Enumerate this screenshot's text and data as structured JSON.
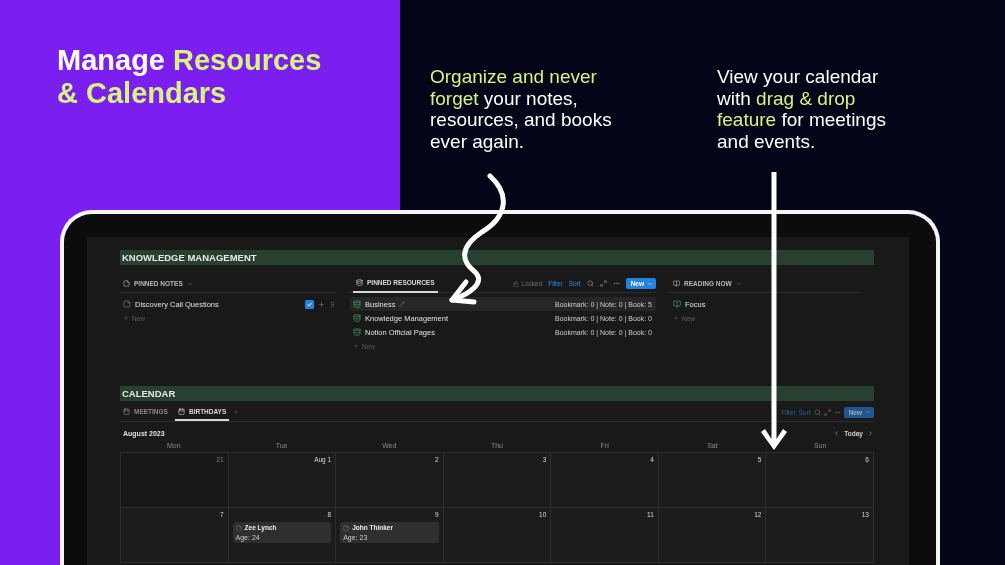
{
  "hero": {
    "title_lines": [
      [
        {
          "text": "Manage ",
          "highlight": false
        },
        {
          "text": "Resources",
          "highlight": true
        }
      ],
      [
        {
          "text": "& Calendars",
          "highlight": true
        }
      ]
    ],
    "captions": [
      [
        {
          "text": "Organize and never forget",
          "highlight": true
        },
        {
          "text": " your notes, resources, and books ever again.",
          "highlight": false
        }
      ],
      [
        {
          "text": "View your calendar with ",
          "highlight": false
        },
        {
          "text": "drag & drop feature",
          "highlight": true
        },
        {
          "text": " for meetings and events.",
          "highlight": false
        }
      ]
    ]
  },
  "knowledge": {
    "title": "KNOWLEDGE MANAGEMENT",
    "pinned_notes": {
      "title": "PINNED NOTES",
      "new_label": "New",
      "items": [
        {
          "label": "Discovery Call Questions",
          "checked": true
        }
      ]
    },
    "pinned_resources": {
      "tab": "PINNED RESOURCES",
      "locked": "Locked",
      "filter": "Filter",
      "sort": "Sort",
      "new_button": "New",
      "new_label": "New",
      "items": [
        {
          "label": "Business",
          "summary": "Bookmark: 0 | Note: 0 | Book: 5",
          "hovered": true
        },
        {
          "label": "Knowledge Management",
          "summary": "Bookmark: 0 | Note: 0 | Book: 0",
          "hovered": false
        },
        {
          "label": "Notion Official Pages",
          "summary": "Bookmark: 0 | Note: 0 | Book: 0",
          "hovered": false
        }
      ]
    },
    "reading_now": {
      "title": "READING NOW",
      "new_label": "New",
      "items": [
        {
          "label": "Focus"
        }
      ]
    }
  },
  "calendar": {
    "title": "CALENDAR",
    "tabs": [
      {
        "label": "MEETINGS",
        "selected": false
      },
      {
        "label": "BIRTHDAYS",
        "selected": true
      }
    ],
    "toolbar": {
      "filter": "Filter",
      "sort": "Sort",
      "new_button": "New"
    },
    "month": "August 2023",
    "today": "Today",
    "weekdays": [
      "Mon",
      "Tue",
      "Wed",
      "Thu",
      "Fri",
      "Sat",
      "Sun"
    ],
    "weeks": [
      [
        {
          "day": "21",
          "in_month": false
        },
        {
          "day": "Aug 1",
          "in_month": true
        },
        {
          "day": "2",
          "in_month": true
        },
        {
          "day": "3",
          "in_month": true
        },
        {
          "day": "4",
          "in_month": true
        },
        {
          "day": "5",
          "in_month": true
        },
        {
          "day": "6",
          "in_month": true
        }
      ],
      [
        {
          "day": "7",
          "in_month": true
        },
        {
          "day": "8",
          "in_month": true,
          "events": [
            {
              "title": "Zee Lynch",
              "detail": "Age: 24"
            }
          ]
        },
        {
          "day": "9",
          "in_month": true,
          "events": [
            {
              "title": "John Thinker",
              "detail": "Age: 23"
            }
          ]
        },
        {
          "day": "10",
          "in_month": true
        },
        {
          "day": "11",
          "in_month": true
        },
        {
          "day": "12",
          "in_month": true
        },
        {
          "day": "13",
          "in_month": true
        }
      ]
    ]
  }
}
